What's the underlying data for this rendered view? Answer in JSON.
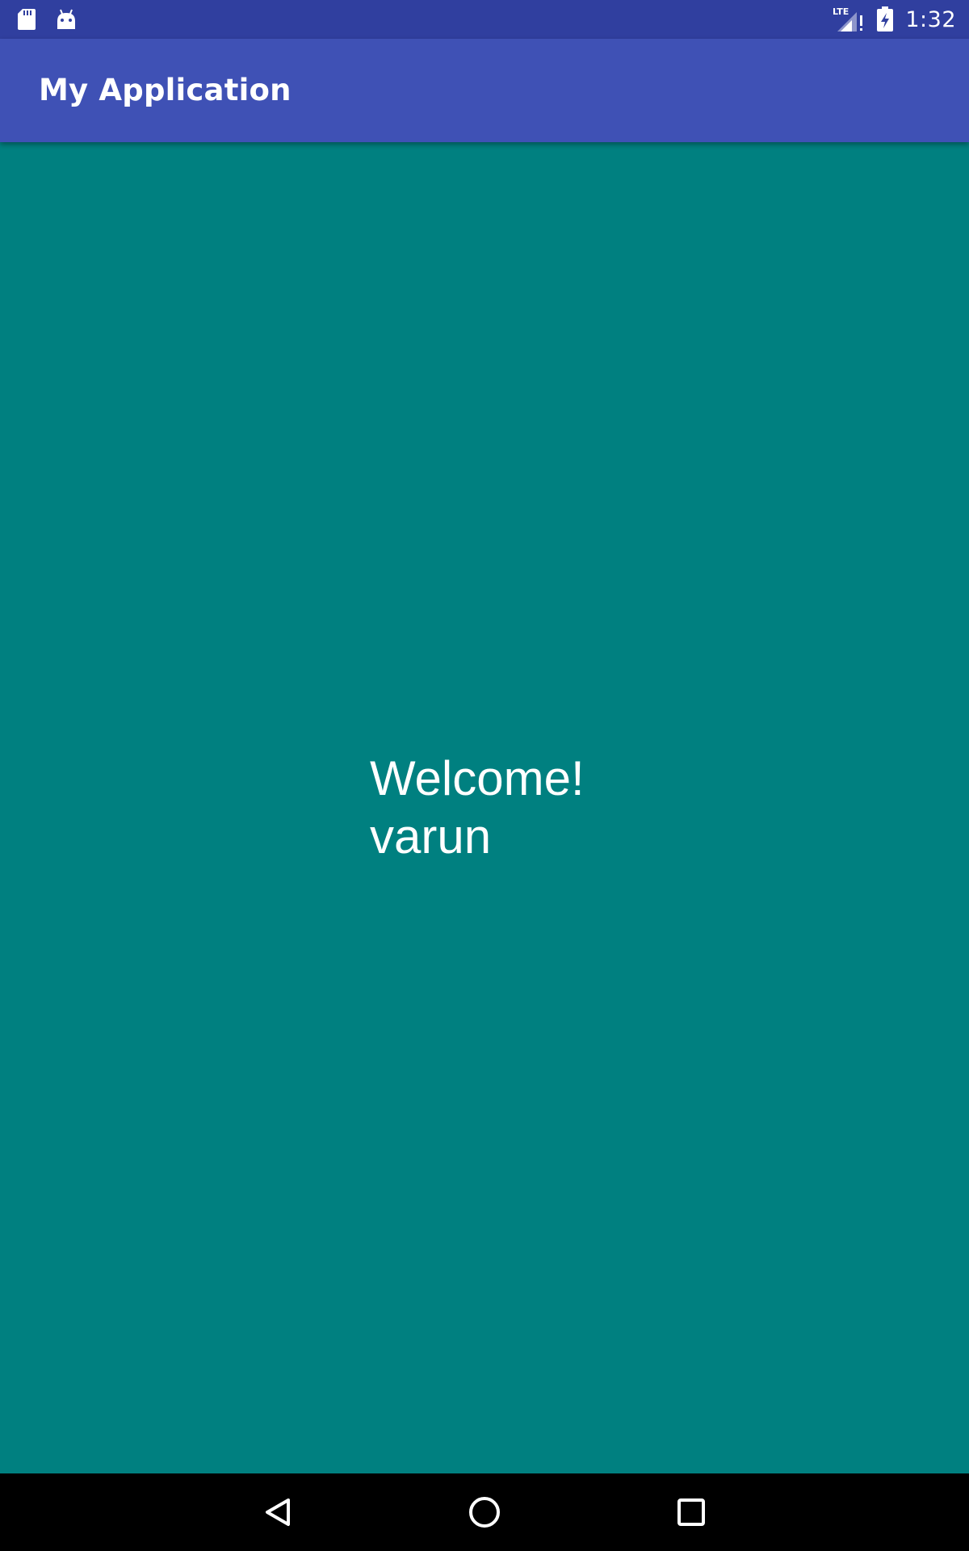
{
  "status_bar": {
    "time": "1:32",
    "network_label": "LTE",
    "icons": [
      "sd-card-icon",
      "android-debug-icon",
      "lte-signal-icon",
      "battery-charging-icon"
    ],
    "background_color": "#303F9F"
  },
  "app_bar": {
    "title": "My Application",
    "background_color": "#3F51B5"
  },
  "content": {
    "message": "Welcome!\nvarun",
    "background_color": "#008080"
  },
  "nav_bar": {
    "buttons": [
      "back-icon",
      "home-icon",
      "recents-icon"
    ]
  }
}
